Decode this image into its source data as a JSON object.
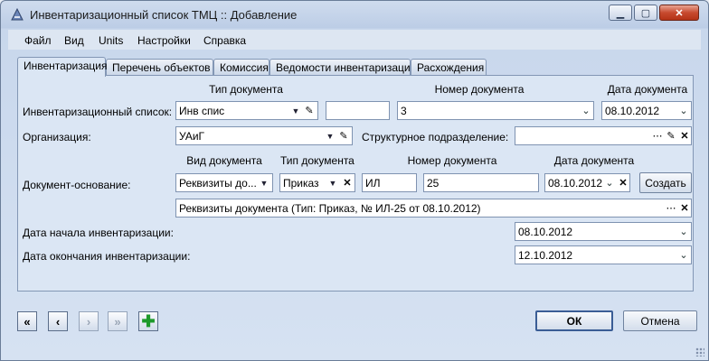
{
  "window": {
    "title": "Инвентаризационный список ТМЦ :: Добавление"
  },
  "menu": [
    "Файл",
    "Вид",
    "Units",
    "Настройки",
    "Справка"
  ],
  "tabs": [
    "Инвентаризация",
    "Перечень объектов",
    "Комиссия",
    "Ведомости инвентаризации",
    "Расхождения"
  ],
  "headers": {
    "doc_type": "Тип документа",
    "doc_number": "Номер документа",
    "doc_date": "Дата документа",
    "base_kind": "Вид документа",
    "base_type": "Тип документа",
    "base_number": "Номер документа",
    "base_date": "Дата документа"
  },
  "labels": {
    "inv_list": "Инвентаризационный список:",
    "org": "Организация:",
    "subdivision": "Структурное подразделение:",
    "base_doc": "Документ-основание:",
    "start_date": "Дата начала инвентаризации:",
    "end_date": "Дата окончания инвентаризации:"
  },
  "fields": {
    "doc_type": "Инв спис",
    "doc_prefix": "",
    "doc_number": "3",
    "doc_date": "08.10.2012",
    "org": "УАиГ",
    "subdivision": "",
    "base_kind": "Реквизиты до...",
    "base_type": "Приказ",
    "base_prefix": "ИЛ",
    "base_number": "25",
    "base_date": "08.10.2012",
    "base_summary": "Реквизиты документа (Тип: Приказ, № ИЛ-25 от 08.10.2012)",
    "start_date": "08.10.2012",
    "end_date": "12.10.2012"
  },
  "buttons": {
    "create": "Создать",
    "ok": "ОК",
    "cancel": "Отмена"
  },
  "icons": [
    "app-icon",
    "minimize-icon",
    "maximize-icon",
    "close-icon",
    "dropdown-arrow-icon",
    "pick-icon",
    "clear-icon",
    "ellipsis-icon",
    "chevron-down-icon",
    "first-record-icon",
    "prev-record-icon",
    "next-record-icon",
    "last-record-icon",
    "add-icon"
  ]
}
